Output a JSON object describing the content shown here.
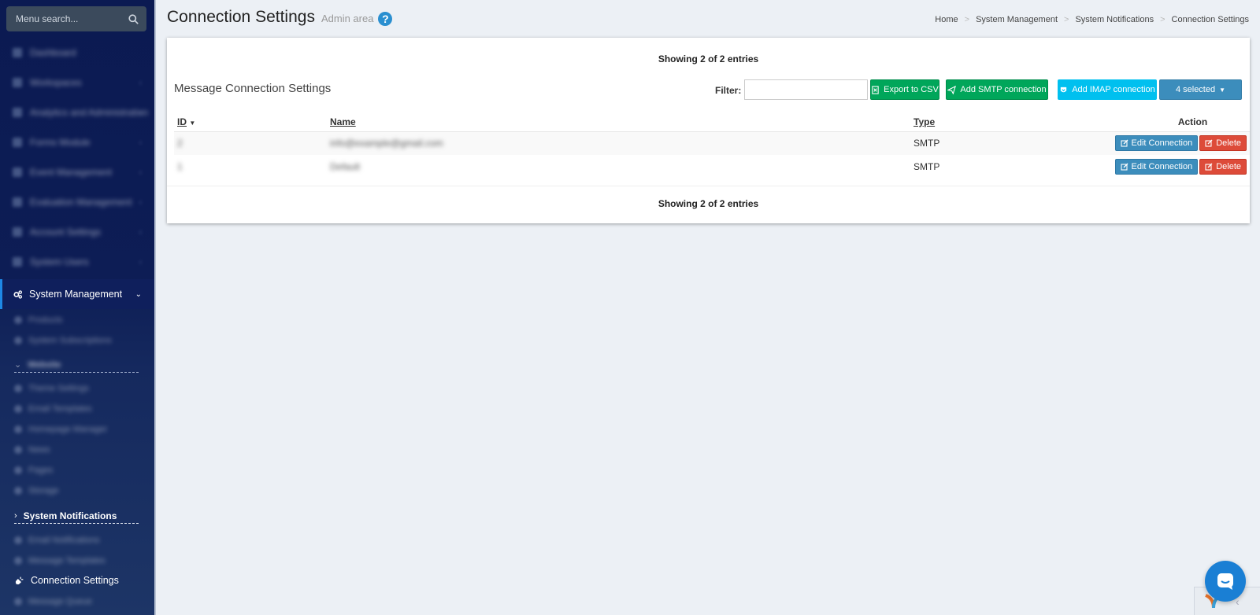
{
  "sidebar": {
    "search_placeholder": "Menu search...",
    "blurred_items": [
      "Dashboard",
      "Workspaces",
      "Analytics and Administration",
      "Forms Module",
      "Event Management",
      "Evaluation Management",
      "Account Settings",
      "System Users"
    ],
    "active_section": "System Management",
    "sub_items": [
      "Products",
      "System Subscriptions"
    ],
    "group_header": "Website",
    "group_items": [
      "Theme Settings",
      "Email Templates",
      "Homepage Manager",
      "News",
      "Pages",
      "Storage"
    ],
    "notifications_label": "System Notifications",
    "notification_items": [
      "Email Notifications",
      "Message Templates"
    ],
    "current_item": "Connection Settings",
    "last_item": "Message Queue"
  },
  "header": {
    "title": "Connection Settings",
    "subtitle": "Admin area",
    "help_glyph": "?"
  },
  "breadcrumb": [
    "Home",
    "System Management",
    "System Notifications",
    "Connection Settings"
  ],
  "panel": {
    "showing_top": "Showing 2 of 2 entries",
    "showing_bottom": "Showing 2 of 2 entries",
    "title": "Message Connection Settings",
    "filter_label": "Filter:",
    "filter_value": "",
    "buttons": {
      "export": "Export to CSV",
      "add_smtp": "Add SMTP connection",
      "add_imap": "Add IMAP connection",
      "selected": "4 selected"
    }
  },
  "table": {
    "headers": {
      "id": "ID",
      "name": "Name",
      "type": "Type",
      "action": "Action"
    },
    "rows": [
      {
        "id": "2",
        "name": "info@example@gmail.com",
        "type": "SMTP",
        "edit": "Edit Connection",
        "delete": "Delete"
      },
      {
        "id": "1",
        "name": "Default",
        "type": "SMTP",
        "edit": "Edit Connection",
        "delete": "Delete"
      }
    ]
  },
  "colors": {
    "sidebar_bg": "#0b1a52",
    "accent_green": "#00a65a",
    "accent_cyan": "#00c0ef",
    "accent_blue": "#3c8dbc",
    "danger_red": "#dd4b39",
    "chat_blue": "#1a7fd4"
  }
}
